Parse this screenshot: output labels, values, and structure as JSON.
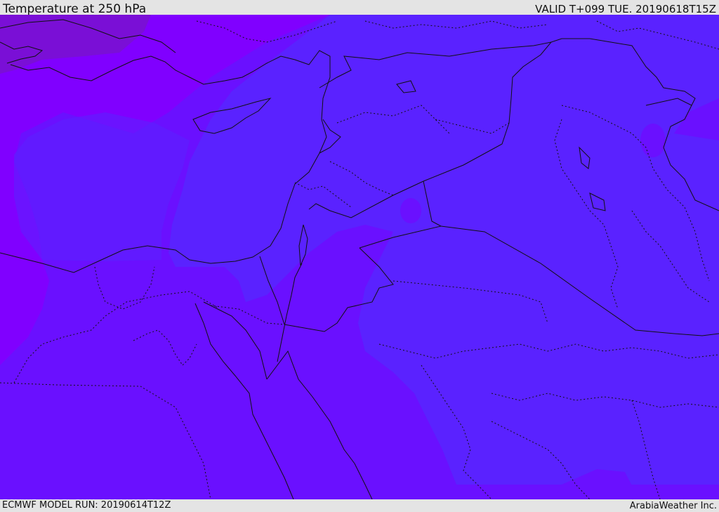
{
  "header": {
    "title": "Temperature at 250 hPa",
    "valid_time": "VALID T+099 TUE. 20190618T15Z"
  },
  "footer": {
    "model_run": "ECMWF MODEL RUN: 20190614T12Z",
    "credit": "ArabiaWeather Inc."
  },
  "map": {
    "colors": {
      "coldest": "#7a0fd6",
      "cold": "#8000ff",
      "mid": "#6a10ff",
      "warm": "#5a22ff",
      "border": "#111111"
    }
  }
}
